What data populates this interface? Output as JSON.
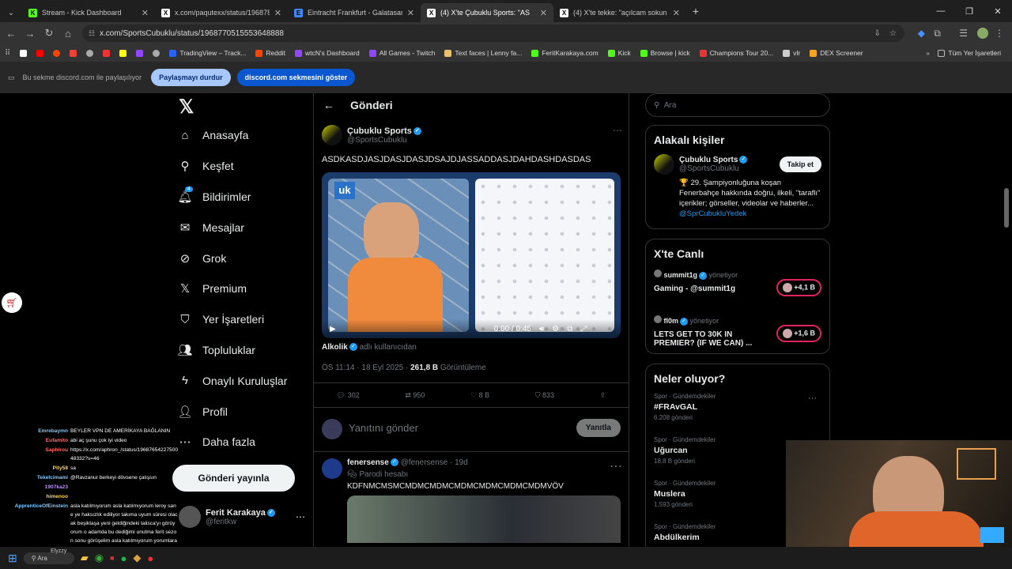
{
  "tabs": [
    {
      "title": "Stream - Kick Dashboard",
      "color": "#53fc18",
      "glyph": "K"
    },
    {
      "title": "x.com/paqutexx/status/196878",
      "color": "#ffffff",
      "glyph": "X"
    },
    {
      "title": "Eintracht Frankfurt - Galatasara",
      "color": "#4285f4",
      "glyph": "E"
    },
    {
      "title": "(4) X'te Çubuklu Sports: \"AS",
      "color": "#ffffff",
      "glyph": "X"
    },
    {
      "title": "(4) X'te tekke: \"açılcam sokun h",
      "color": "#ffffff",
      "glyph": "X"
    }
  ],
  "new_tab": "+",
  "address": "x.com/SportsCubuklu/status/1968770515553648888",
  "bookmarks": [
    "TradingView – Track...",
    "Reddit",
    "wtcN's Dashboard",
    "All Games - Twitch",
    "Text faces | Lenny fa...",
    "FeritKarakaya.com",
    "Kick",
    "Browse | kick",
    "Champions Tour 20...",
    "vlr",
    "DEX Screener"
  ],
  "bookmarks_all": "Tüm Yer İşaretleri",
  "share": {
    "text": "Bu sekme discord.com ile paylaşılıyor",
    "stop": "Paylaşmayı durdur",
    "show": "discord.com sekmesini göster"
  },
  "nav": {
    "items": [
      {
        "label": "Anasayfa",
        "icon": "home-icon",
        "glyph": "⌂"
      },
      {
        "label": "Keşfet",
        "icon": "search-icon",
        "glyph": "⚲"
      },
      {
        "label": "Bildirimler",
        "icon": "bell-icon",
        "glyph": "🔔︎"
      },
      {
        "label": "Mesajlar",
        "icon": "mail-icon",
        "glyph": "✉"
      },
      {
        "label": "Grok",
        "icon": "grok-icon",
        "glyph": "⊘"
      },
      {
        "label": "Premium",
        "icon": "x-icon",
        "glyph": "𝕏"
      },
      {
        "label": "Yer İşaretleri",
        "icon": "bookmark-icon",
        "glyph": "⛉"
      },
      {
        "label": "Topluluklar",
        "icon": "people-icon",
        "glyph": "👥︎"
      },
      {
        "label": "Onaylı Kuruluşlar",
        "icon": "lightning-icon",
        "glyph": "ϟ"
      },
      {
        "label": "Profil",
        "icon": "person-icon",
        "glyph": "👤︎"
      },
      {
        "label": "Daha fazla",
        "icon": "more-icon",
        "glyph": "⋯"
      }
    ],
    "notif_badge": "4",
    "post": "Gönderi yayınla",
    "profile_name": "Ferit Karakaya",
    "profile_handle": "@feritkw"
  },
  "main": {
    "header": "Gönderi",
    "author": "Çubuklu Sports",
    "handle": "@SportsCubuklu",
    "text": "ASDKASDJASJDASJDASJDSAJDJASSADDASJDAHDASHDASDAS",
    "video_time": "0:00 / 0:45",
    "video_logo": "uk",
    "from_label": "Alkolik",
    "from_suffix": "adlı kullanıcıdan",
    "meta_time": "ÖS 11:14 · 18 Eyl 2025 · ",
    "views": "261,8 B",
    "views_label": "Görüntüleme",
    "stats": {
      "replies": "302",
      "reposts": "950",
      "likes": "8 B",
      "bookmarks": "833"
    },
    "reply_placeholder": "Yanıtını gönder",
    "reply_btn": "Yanıtla",
    "next": {
      "author": "fenersense",
      "handle": "@fenersense · 19d",
      "tag": "Parodi hesabı",
      "text": "KDFNMCMSMCMDMCMDMCMDMCMDMCMDMCMDMVÖV"
    }
  },
  "right": {
    "search": "Ara",
    "relevant_title": "Alakalı kişiler",
    "rel_name": "Çubuklu Sports",
    "rel_handle": "@SportsCubuklu",
    "follow": "Takip et",
    "rel_bio": "🏆 29. Şampiyonluğuna koşan Fenerbahçe hakkında doğru, ilkeli, \"taraflı\" içerikler; görseller, videolar ve haberler...",
    "rel_link": "@SprCubukluYedek",
    "live_title": "X'te Canlı",
    "live": [
      {
        "host": "summit1g",
        "role": "yönetiyor",
        "title": "Gaming - @summit1g",
        "count": "+4,1 B"
      },
      {
        "host": "fl0m",
        "role": "yönetiyor",
        "title": "LETS GET TO 30K IN PREMIER? (IF WE CAN) ...",
        "count": "+1,6 B"
      }
    ],
    "trends_title": "Neler oluyor?",
    "trends": [
      {
        "cat": "Spor · Gündemdekiler",
        "name": "#FRAvGAL",
        "count": "6.208 gönderi"
      },
      {
        "cat": "Spor · Gündemdekiler",
        "name": "Uğurcan",
        "count": "18,8 B gönderi"
      },
      {
        "cat": "Spor · Gündemdekiler",
        "name": "Muslera",
        "count": "1.593 gönderi"
      },
      {
        "cat": "Spor · Gündemdekiler",
        "name": "Abdülkerim",
        "count": ""
      }
    ]
  },
  "chat": [
    {
      "user": "Emrebaymn",
      "color": "#7ec8ff",
      "msg": "BEYLER VPN DE AMERİKAYA BAĞLANIN"
    },
    {
      "user": "Eufamito",
      "color": "#ff6b6b",
      "msg": "abi aç şunu çok iyi video"
    },
    {
      "user": "Saphirou",
      "color": "#ff6b6b",
      "msg": "https://x.com/aphron_/status/1968765422750048332?s=46"
    },
    {
      "user": "Pity58",
      "color": "#ffd34d",
      "msg": "sa"
    },
    {
      "user": "Tekelcimami",
      "color": "#7ec8ff",
      "msg": "@Ravzanur berkeyi dövsene çalışsın"
    },
    {
      "user": "1907ka23",
      "color": "#c08cff",
      "msg": ""
    },
    {
      "user": "himenoo",
      "color": "#ffd34d",
      "msg": ""
    },
    {
      "user": "ApprenticeOfEinstein",
      "color": "#7ec8ff",
      "msg": "asla katılmıyorum asla katılmıyorum leroy sane ye haksızlık ediliyor takıma uyum süresi olacak beşiktaşa yeni geldiğindeki talisca'yı görüyorum o adamda bu dediğimi unutma ferit sezon sonu görüşelim asla katılmıyorum yorumlara sane ile ilgili ülke takımı kaybeden..."
    }
  ],
  "taskbar": {
    "search": "Ara",
    "weather": "Elyzzy"
  }
}
